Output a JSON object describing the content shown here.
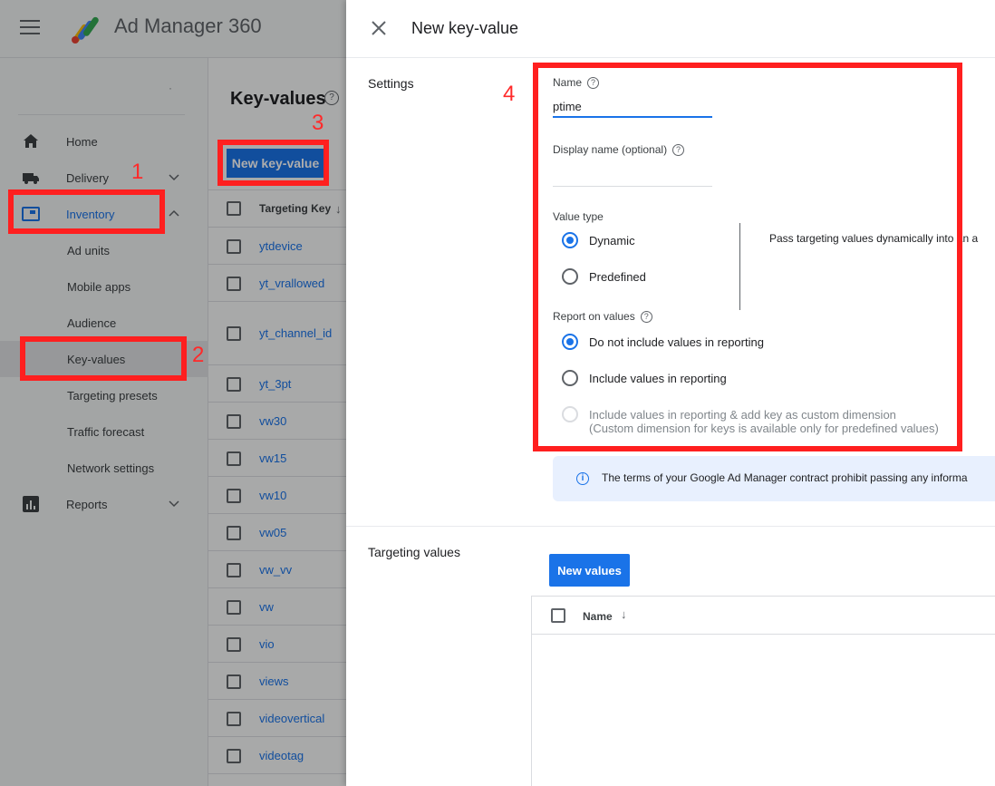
{
  "app": {
    "title": "Ad Manager 360"
  },
  "sidebar": {
    "items": [
      {
        "label": "Home",
        "icon": "home-icon"
      },
      {
        "label": "Delivery",
        "icon": "truck-icon"
      },
      {
        "label": "Inventory",
        "icon": "inventory-icon"
      },
      {
        "label": "Reports",
        "icon": "bar-chart-icon"
      }
    ],
    "inventory_subitems": [
      "Ad units",
      "Mobile apps",
      "Audience",
      "Key-values",
      "Targeting presets",
      "Traffic forecast",
      "Network settings"
    ]
  },
  "main": {
    "title": "Key-values",
    "new_button": "New key-value",
    "column_header": "Targeting Key",
    "keys": [
      "ytdevice",
      "yt_vrallowed",
      "yt_channel_id",
      "yt_3pt",
      "vw30",
      "vw15",
      "vw10",
      "vw05",
      "vw_vv",
      "vw",
      "vio",
      "views",
      "videovertical",
      "videotag"
    ]
  },
  "callouts": [
    "1",
    "2",
    "3",
    "4"
  ],
  "panel": {
    "title": "New key-value",
    "settings_label": "Settings",
    "name_label": "Name",
    "name_value": "ptime",
    "display_name_label": "Display name (optional)",
    "value_type_label": "Value type",
    "value_type_options": [
      "Dynamic",
      "Predefined"
    ],
    "value_type_selected": "Dynamic",
    "value_type_description": "Pass targeting values dynamically into an a",
    "report_label": "Report on values",
    "report_options": [
      "Do not include values in reporting",
      "Include values in reporting",
      "Include values in reporting & add key as custom dimension"
    ],
    "report_option_note": "(Custom dimension for keys is available only for predefined values)",
    "report_selected": "Do not include values in reporting",
    "info_text": "The terms of your Google Ad Manager contract prohibit passing any informa",
    "targeting_values_label": "Targeting values",
    "new_values_button": "New values",
    "values_column_header": "Name"
  },
  "colors": {
    "accent": "#1a73e8",
    "callout": "#ff1f1f",
    "info_bg": "#e8f0fe"
  }
}
